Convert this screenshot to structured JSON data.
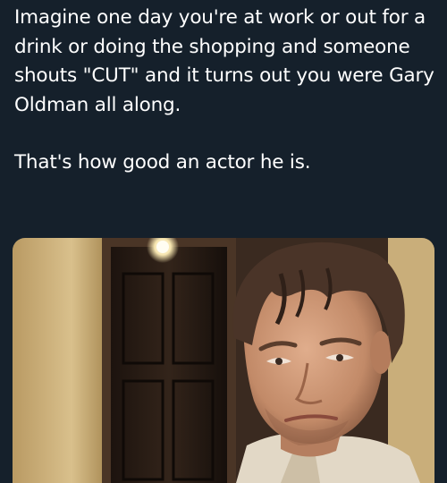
{
  "post": {
    "line_1": "Imagine one day you're at work or out for a drink or doing the shopping and someone shouts \"CUT\" and it turns out you were Gary Oldman all along.",
    "line_2": "That's how good an actor he is."
  },
  "photo": {
    "depicts": "man-with-wet-hair-in-hallway",
    "colors": {
      "background": "#15202b",
      "text": "#ffffff",
      "wall": "#cdb27a",
      "door": "#2a1e17",
      "skin": "#c58e6e",
      "hair": "#4a3428",
      "shirt": "#e2d8c6"
    }
  }
}
